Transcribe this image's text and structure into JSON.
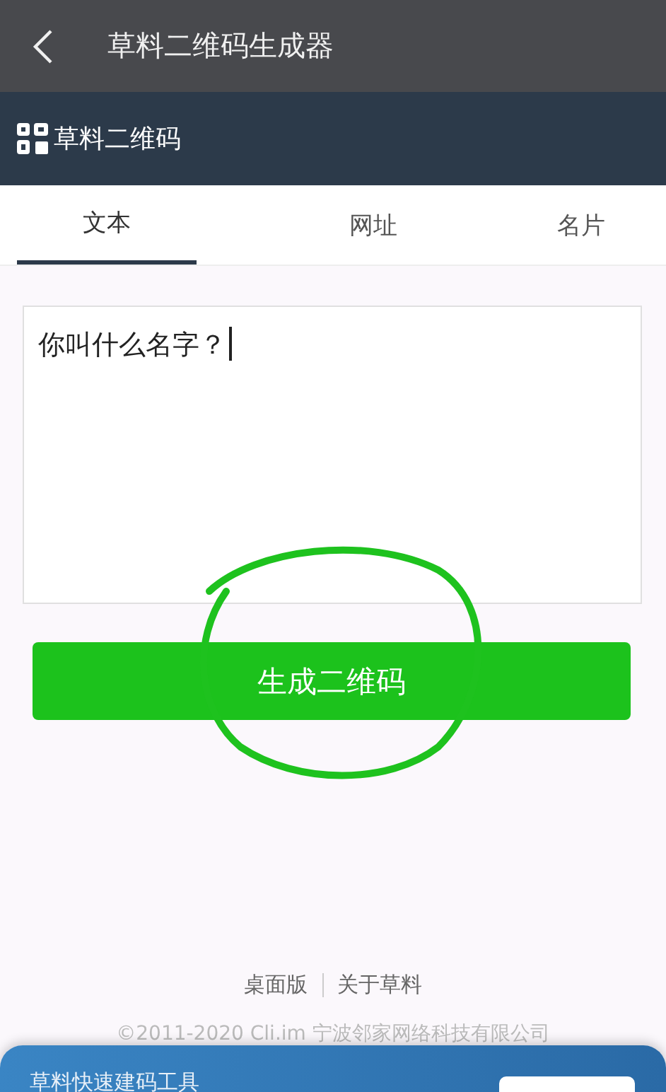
{
  "top_bar": {
    "title": "草料二维码生成器"
  },
  "header": {
    "logo_text": "草料二维码"
  },
  "tabs": [
    {
      "label": "文本",
      "selected": true
    },
    {
      "label": "网址",
      "selected": false
    },
    {
      "label": "名片",
      "selected": false
    }
  ],
  "text_input": {
    "value": "你叫什么名字？",
    "focused": true
  },
  "generate_button": "生成二维码",
  "footer": {
    "links": [
      "桌面版",
      "关于草料"
    ],
    "copyright": "©2011-2020 Cli.im 宁波邻家网络科技有限公司"
  },
  "banner": {
    "title": "草料快速建码工具"
  }
}
